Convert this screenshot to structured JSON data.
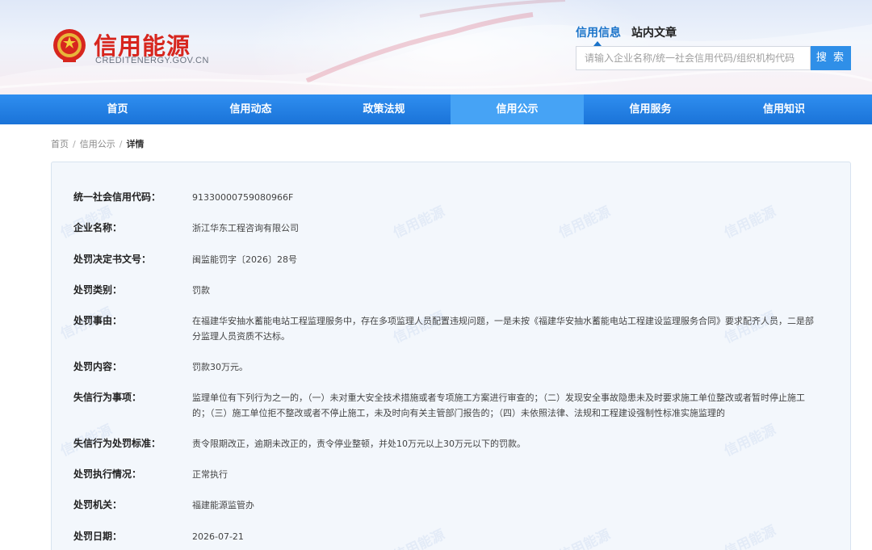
{
  "site": {
    "title": "信用能源",
    "domain": "CREDITENERGY.GOV.CN",
    "emblem_icon": "national-emblem-icon"
  },
  "search": {
    "tabs": [
      {
        "label": "信用信息",
        "active": true
      },
      {
        "label": "站内文章",
        "active": false
      }
    ],
    "placeholder": "请输入企业名称/统一社会信用代码/组织机构代码",
    "button_label": "搜 索"
  },
  "nav": {
    "items": [
      {
        "label": "首页",
        "active": false
      },
      {
        "label": "信用动态",
        "active": false
      },
      {
        "label": "政策法规",
        "active": false
      },
      {
        "label": "信用公示",
        "active": true
      },
      {
        "label": "信用服务",
        "active": false
      },
      {
        "label": "信用知识",
        "active": false
      }
    ]
  },
  "breadcrumb": {
    "items": [
      "首页",
      "信用公示"
    ],
    "current": "详情",
    "separator": "/"
  },
  "watermark_text": "信用能源",
  "details": [
    {
      "label": "统一社会信用代码：",
      "value": "91330000759080966F"
    },
    {
      "label": "企业名称：",
      "value": "浙江华东工程咨询有限公司"
    },
    {
      "label": "处罚决定书文号：",
      "value": "闽监能罚字〔2026〕28号"
    },
    {
      "label": "处罚类别：",
      "value": "罚款"
    },
    {
      "label": "处罚事由：",
      "value": "在福建华安抽水蓄能电站工程监理服务中，存在多项监理人员配置违规问题，一是未按《福建华安抽水蓄能电站工程建设监理服务合同》要求配齐人员，二是部分监理人员资质不达标。"
    },
    {
      "label": "处罚内容：",
      "value": "罚款30万元。"
    },
    {
      "label": "失信行为事项：",
      "value": "监理单位有下列行为之一的，（一）未对重大安全技术措施或者专项施工方案进行审查的；（二）发现安全事故隐患未及时要求施工单位整改或者暂时停止施工的；（三）施工单位拒不整改或者不停止施工，未及时向有关主管部门报告的；（四）未依照法律、法规和工程建设强制性标准实施监理的"
    },
    {
      "label": "失信行为处罚标准：",
      "value": "责令限期改正，逾期未改正的，责令停业整顿，并处10万元以上30万元以下的罚款。"
    },
    {
      "label": "处罚执行情况：",
      "value": "正常执行"
    },
    {
      "label": "处罚机关：",
      "value": "福建能源监管办"
    },
    {
      "label": "处罚日期：",
      "value": "2026-07-21"
    }
  ],
  "colors": {
    "brand_red": "#d7261e",
    "nav_blue": "#1a73d8",
    "nav_active": "#46a3f5",
    "accent_blue": "#1a73c9",
    "search_button": "#2f8fe8"
  }
}
